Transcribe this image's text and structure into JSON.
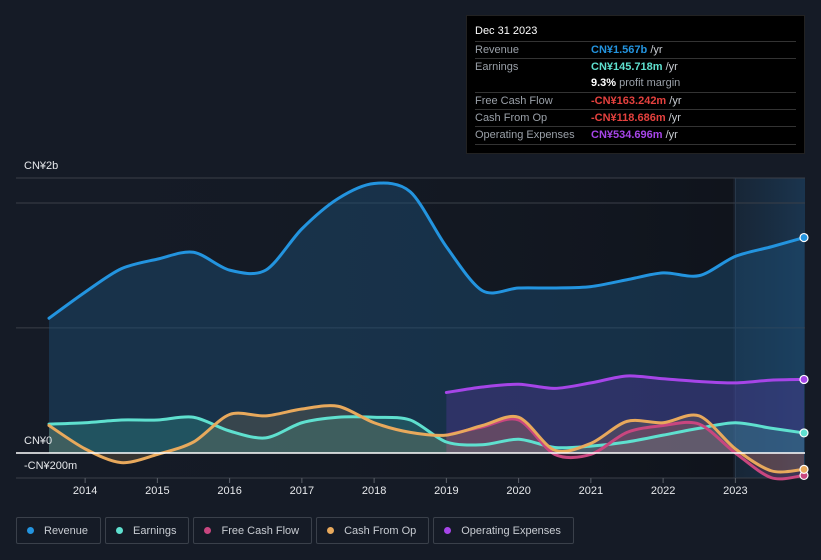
{
  "tooltip": {
    "date": "Dec 31 2023",
    "rows": [
      {
        "label": "Revenue",
        "value": "CN¥1.567b",
        "unit": " /yr",
        "color": "#2394df"
      },
      {
        "label": "Earnings",
        "value": "CN¥145.718m",
        "unit": " /yr",
        "color": "#5fe0cf"
      },
      {
        "label": "Free Cash Flow",
        "value": "-CN¥163.242m",
        "unit": " /yr",
        "color": "#e5413e"
      },
      {
        "label": "Cash From Op",
        "value": "-CN¥118.686m",
        "unit": " /yr",
        "color": "#e5413e"
      },
      {
        "label": "Operating Expenses",
        "value": "CN¥534.696m",
        "unit": " /yr",
        "color": "#a645e8"
      }
    ],
    "profit_margin_value": "9.3%",
    "profit_margin_text": " profit margin"
  },
  "legend": [
    {
      "label": "Revenue",
      "color": "#2394df"
    },
    {
      "label": "Earnings",
      "color": "#5fe0cf"
    },
    {
      "label": "Free Cash Flow",
      "color": "#c8467f"
    },
    {
      "label": "Cash From Op",
      "color": "#e8a95c"
    },
    {
      "label": "Operating Expenses",
      "color": "#a645e8"
    }
  ],
  "chart_data": {
    "type": "area",
    "title": "",
    "xlabel": "",
    "ylabel": "",
    "y_tick_labels": [
      "CN¥2b",
      "CN¥0",
      "-CN¥200m"
    ],
    "x_tick_labels": [
      "2014",
      "2015",
      "2016",
      "2017",
      "2018",
      "2019",
      "2020",
      "2021",
      "2022",
      "2023"
    ],
    "xlim": [
      2013.5,
      2023.95
    ],
    "ylim": [
      -0.2,
      2.0
    ],
    "y_unit": "CN¥ billions",
    "forecast_shade_from": 2023.0,
    "series": [
      {
        "name": "Revenue",
        "color": "#2394df",
        "x": [
          2013.5,
          2014.0,
          2014.5,
          2015.0,
          2015.5,
          2016.0,
          2016.5,
          2017.0,
          2017.5,
          2018.0,
          2018.5,
          2019.0,
          2019.5,
          2020.0,
          2020.5,
          2021.0,
          2021.5,
          2022.0,
          2022.5,
          2023.0,
          2023.5,
          2023.95
        ],
        "values": [
          0.98,
          1.17,
          1.34,
          1.41,
          1.46,
          1.33,
          1.33,
          1.63,
          1.85,
          1.96,
          1.9,
          1.5,
          1.18,
          1.2,
          1.2,
          1.21,
          1.26,
          1.31,
          1.29,
          1.43,
          1.5,
          1.567
        ]
      },
      {
        "name": "Earnings",
        "color": "#5fe0cf",
        "x": [
          2013.5,
          2014.0,
          2014.5,
          2015.0,
          2015.5,
          2016.0,
          2016.5,
          2017.0,
          2017.5,
          2018.0,
          2018.5,
          2019.0,
          2019.5,
          2020.0,
          2020.5,
          2021.0,
          2021.5,
          2022.0,
          2022.5,
          2023.0,
          2023.5,
          2023.95
        ],
        "values": [
          0.21,
          0.22,
          0.24,
          0.24,
          0.26,
          0.16,
          0.11,
          0.22,
          0.26,
          0.26,
          0.24,
          0.08,
          0.06,
          0.1,
          0.04,
          0.05,
          0.08,
          0.13,
          0.18,
          0.22,
          0.18,
          0.146
        ]
      },
      {
        "name": "Free Cash Flow",
        "color": "#c8467f",
        "x": [
          2019.0,
          2019.5,
          2020.0,
          2020.5,
          2021.0,
          2021.5,
          2022.0,
          2022.5,
          2023.0,
          2023.5,
          2023.95
        ],
        "values": [
          0.13,
          0.19,
          0.24,
          -0.01,
          -0.01,
          0.15,
          0.2,
          0.21,
          0.0,
          -0.18,
          -0.163
        ]
      },
      {
        "name": "Cash From Op",
        "color": "#e8a95c",
        "x": [
          2013.5,
          2014.0,
          2014.5,
          2015.0,
          2015.5,
          2016.0,
          2016.5,
          2017.0,
          2017.5,
          2018.0,
          2018.5,
          2019.0,
          2019.5,
          2020.0,
          2020.5,
          2021.0,
          2021.5,
          2022.0,
          2022.5,
          2023.0,
          2023.5,
          2023.95
        ],
        "values": [
          0.2,
          0.03,
          -0.07,
          -0.01,
          0.08,
          0.28,
          0.27,
          0.32,
          0.34,
          0.22,
          0.15,
          0.13,
          0.2,
          0.26,
          0.02,
          0.07,
          0.23,
          0.22,
          0.27,
          0.03,
          -0.13,
          -0.119
        ]
      },
      {
        "name": "Operating Expenses",
        "color": "#a645e8",
        "x": [
          2019.0,
          2019.5,
          2020.0,
          2020.5,
          2021.0,
          2021.5,
          2022.0,
          2022.5,
          2023.0,
          2023.5,
          2023.95
        ],
        "values": [
          0.44,
          0.48,
          0.5,
          0.47,
          0.51,
          0.56,
          0.54,
          0.52,
          0.51,
          0.53,
          0.535
        ]
      }
    ]
  }
}
